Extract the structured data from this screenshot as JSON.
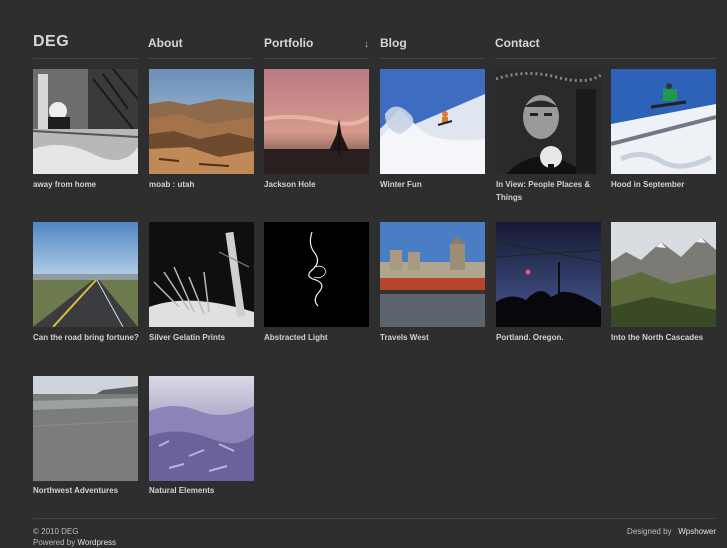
{
  "nav": {
    "logo": "DEG",
    "about": "About",
    "portfolio": "Portfolio",
    "portfolio_arrow": "↓",
    "blog": "Blog",
    "contact": "Contact"
  },
  "gallery": [
    {
      "caption": "away from home",
      "theme": "porch"
    },
    {
      "caption": "moab : utah",
      "theme": "canyon"
    },
    {
      "caption": "Jackson Hole",
      "theme": "sunset"
    },
    {
      "caption": "Winter Fun",
      "theme": "snow-jump"
    },
    {
      "caption": "In View: People Places & Things",
      "theme": "portrait"
    },
    {
      "caption": "Hood in September",
      "theme": "snowboard"
    },
    {
      "caption": "Can the road bring fortune?",
      "theme": "road"
    },
    {
      "caption": "Silver Gelatin Prints",
      "theme": "bw-branches"
    },
    {
      "caption": "Abstracted Light",
      "theme": "light-trace"
    },
    {
      "caption": "Travels West",
      "theme": "train"
    },
    {
      "caption": "Portland. Oregon.",
      "theme": "dusk"
    },
    {
      "caption": "Into the North Cascades",
      "theme": "mountains"
    },
    {
      "caption": "Northwest Adventures",
      "theme": "beach"
    },
    {
      "caption": "Natural Elements",
      "theme": "frost"
    }
  ],
  "footer": {
    "copyright": "© 2010 DEG",
    "powered_prefix": "Powered by",
    "powered_link": "Wordpress",
    "designed_prefix": "Designed by",
    "designed_link": "Wpshower"
  }
}
